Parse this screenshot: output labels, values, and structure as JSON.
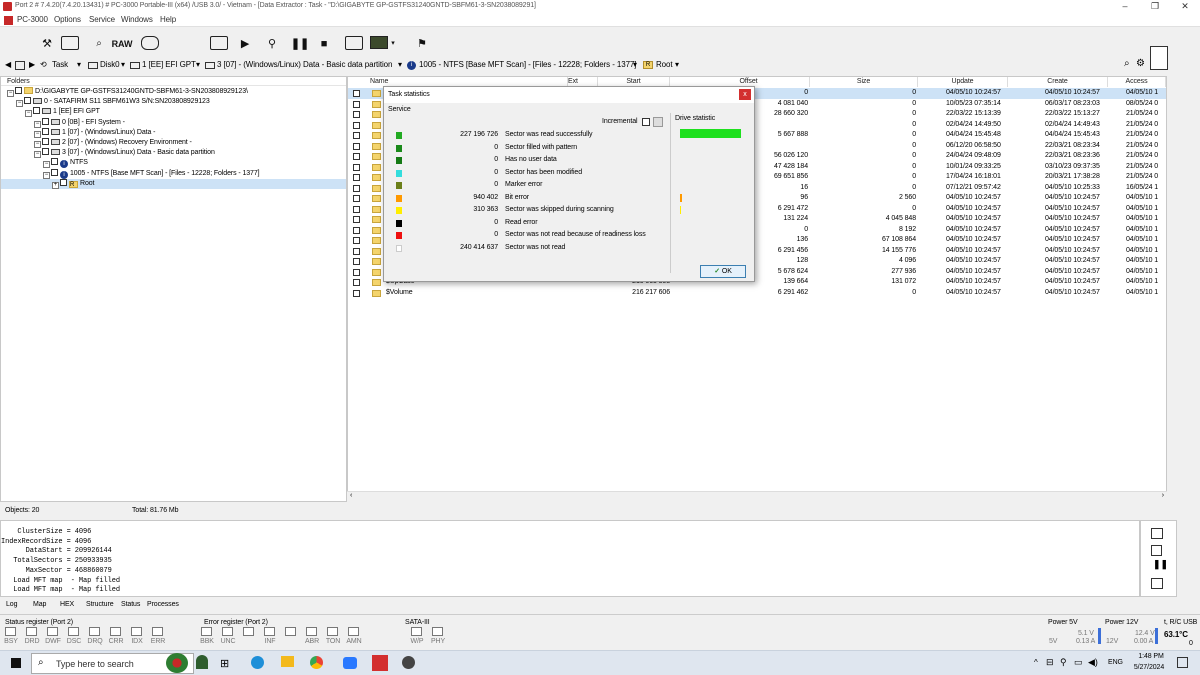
{
  "window": {
    "title": "Port 2 # 7.4.20(7.4.20.13431) # PC-3000 Portable-III (x64) /USB 3.0/ - Vietnam - [Data Extractor : Task - \"D:\\GIGABYTE GP-GSTFS31240GNTD-SBFM61-3-SN2038089291]"
  },
  "menu": {
    "items": [
      "PC-3000",
      "Options",
      "Service",
      "Windows",
      "Help"
    ]
  },
  "toolbar": {
    "raw_label": "RAW"
  },
  "nav": {
    "task": "Task",
    "disk": "Disk0",
    "efi": "1 [EE] EFI GPT",
    "part": "3 [07] - (Windows/Linux) Data - Basic data partition",
    "ntfs": "1005 - NTFS [Base MFT Scan] - [Files - 12228; Folders - 1377]",
    "root": "Root"
  },
  "folders": {
    "header": "Folders",
    "tree": [
      {
        "label": "D:\\GIGABYTE GP-GSTFS31240GNTD-SBFM61-3-SN203808929123\\",
        "indent": 0,
        "icon": "folder"
      },
      {
        "label": "0 - SATAFIRM   S11 SBFM61W3 S/N:SN203808929123",
        "indent": 1,
        "icon": "disk"
      },
      {
        "label": "1 [EE] EFI GPT",
        "indent": 2,
        "icon": "disk"
      },
      {
        "label": "0 [0B] - EFI System -",
        "indent": 3,
        "icon": "disk"
      },
      {
        "label": "1 [07] - (Windows/Linux) Data -",
        "indent": 3,
        "icon": "disk"
      },
      {
        "label": "2 [07] - (Windows) Recovery Environment -",
        "indent": 3,
        "icon": "disk"
      },
      {
        "label": "3 [07] - (Windows/Linux) Data - Basic data partition",
        "indent": 3,
        "icon": "disk"
      },
      {
        "label": "NTFS",
        "indent": 4,
        "icon": "info"
      },
      {
        "label": "1005 - NTFS [Base MFT Scan] - [Files - 12228; Folders - 1377]",
        "indent": 4,
        "icon": "info"
      },
      {
        "label": "Root",
        "indent": 5,
        "icon": "root"
      }
    ]
  },
  "files": {
    "columns": {
      "name": "Name",
      "ext": "Ext",
      "start": "Start",
      "offset": "Offset",
      "size": "Size",
      "update": "Update",
      "create": "Create",
      "access": "Access"
    },
    "rows": [
      {
        "name": "",
        "start": "",
        "offset": "0",
        "size": "0",
        "update": "04/05/10 10:24:57",
        "create": "04/05/10 10:24:57",
        "access": "04/05/10 1"
      },
      {
        "name": "",
        "start": "",
        "offset": "4 081 040",
        "size": "0",
        "update": "10/05/23 07:35:14",
        "create": "06/03/17 08:23:03",
        "access": "08/05/24 0"
      },
      {
        "name": "",
        "start": "",
        "offset": "28 660 320",
        "size": "0",
        "update": "22/03/22 15:13:39",
        "create": "22/03/22 15:13:27",
        "access": "21/05/24 0"
      },
      {
        "name": "",
        "start": "",
        "offset": "",
        "size": "0",
        "update": "02/04/24 14:49:50",
        "create": "02/04/24 14:49:43",
        "access": "21/05/24 0"
      },
      {
        "name": "",
        "start": "",
        "offset": "5 667 888",
        "size": "0",
        "update": "04/04/24 15:45:48",
        "create": "04/04/24 15:45:43",
        "access": "21/05/24 0"
      },
      {
        "name": "",
        "start": "",
        "offset": "",
        "size": "0",
        "update": "06/12/20 06:58:50",
        "create": "22/03/21 08:23:34",
        "access": "21/05/24 0"
      },
      {
        "name": "",
        "start": "",
        "offset": "56 026 120",
        "size": "0",
        "update": "24/04/24 09:48:09",
        "create": "22/03/21 08:23:36",
        "access": "21/05/24 0"
      },
      {
        "name": "",
        "start": "",
        "offset": "47 428 184",
        "size": "0",
        "update": "10/01/24 09:33:25",
        "create": "03/10/23 09:37:35",
        "access": "21/05/24 0"
      },
      {
        "name": "",
        "start": "",
        "offset": "69 651 856",
        "size": "0",
        "update": "17/04/24 16:18:01",
        "create": "20/03/21 17:38:28",
        "access": "21/05/24 0"
      },
      {
        "name": "",
        "start": "",
        "offset": "16",
        "size": "0",
        "update": "07/12/21 09:57:42",
        "create": "04/05/10 10:25:33",
        "access": "16/05/24 1"
      },
      {
        "name": "",
        "start": "",
        "offset": "96",
        "size": "2 560",
        "update": "04/05/10 10:24:57",
        "create": "04/05/10 10:24:57",
        "access": "04/05/10 1"
      },
      {
        "name": "",
        "start": "",
        "offset": "6 291 472",
        "size": "0",
        "update": "04/05/10 10:24:57",
        "create": "04/05/10 10:24:57",
        "access": "04/05/10 1"
      },
      {
        "name": "",
        "start": "",
        "offset": "131 224",
        "size": "4 045 848",
        "update": "04/05/10 10:24:57",
        "create": "04/05/10 10:24:57",
        "access": "04/05/10 1"
      },
      {
        "name": "",
        "start": "",
        "offset": "0",
        "size": "8 192",
        "update": "04/05/10 10:24:57",
        "create": "04/05/10 10:24:57",
        "access": "04/05/10 1"
      },
      {
        "name": "",
        "start": "",
        "offset": "136",
        "size": "67 108 864",
        "update": "04/05/10 10:24:57",
        "create": "04/05/10 10:24:57",
        "access": "04/05/10 1"
      },
      {
        "name": "",
        "start": "",
        "offset": "6 291 456",
        "size": "14 155 776",
        "update": "04/05/10 10:24:57",
        "create": "04/05/10 10:24:57",
        "access": "04/05/10 1"
      },
      {
        "name": "",
        "start": "",
        "offset": "128",
        "size": "4 096",
        "update": "04/05/10 10:24:57",
        "create": "04/05/10 10:24:57",
        "access": "04/05/10 1"
      },
      {
        "name": "",
        "start": "",
        "offset": "5 678 624",
        "size": "277 936",
        "update": "04/05/10 10:24:57",
        "create": "04/05/10 10:24:57",
        "access": "04/05/10 1"
      },
      {
        "name": "$UpCase",
        "start": "210 065 808",
        "offset": "139 664",
        "size": "131 072",
        "update": "04/05/10 10:24:57",
        "create": "04/05/10 10:24:57",
        "access": "04/05/10 1"
      },
      {
        "name": "$Volume",
        "start": "216 217 606",
        "offset": "6 291 462",
        "size": "0",
        "update": "04/05/10 10:24:57",
        "create": "04/05/10 10:24:57",
        "access": "04/05/10 1"
      }
    ]
  },
  "dialog": {
    "title": "Task statistics",
    "service": "Service",
    "incremental": "Incremental",
    "drive_statistic": "Drive statistic",
    "ok": "OK",
    "stats": [
      {
        "value": "227 196 726",
        "label": "Sector was read successfully",
        "color": "#22aa22"
      },
      {
        "value": "0",
        "label": "Sector filled with pattern",
        "color": "#1a8a1a"
      },
      {
        "value": "0",
        "label": "Has no user data",
        "color": "#157a15"
      },
      {
        "value": "0",
        "label": "Sector has been modified",
        "color": "#33dddd"
      },
      {
        "value": "0",
        "label": "Marker error",
        "color": "#6b7f1a"
      },
      {
        "value": "940 402",
        "label": "Bit error",
        "color": "#ff9900"
      },
      {
        "value": "310 363",
        "label": "Sector was skipped during scanning",
        "color": "#ffee00"
      },
      {
        "value": "0",
        "label": "Read error",
        "color": "#000000"
      },
      {
        "value": "0",
        "label": "Sector was not read because of readiness loss",
        "color": "#ee1111"
      },
      {
        "value": "240 414 637",
        "label": "Sector was not read",
        "color": "#ffffff"
      }
    ]
  },
  "objects": {
    "count": "Objects: 20",
    "total": "Total: 81.76 Mb"
  },
  "log": {
    "lines": [
      "    ClusterSize = 4096",
      "IndexRecordSize = 4096",
      "      DataStart = 209926144",
      "   TotalSectors = 250933935",
      "      MaxSector = 468860079",
      "   Load MFT map  - Map filled",
      "   Load MFT map  - Map filled"
    ]
  },
  "bottom_tabs": [
    "Log",
    "Map",
    "HEX",
    "Structure",
    "Status",
    "Processes"
  ],
  "status": {
    "status_reg_title": "Status register (Port 2)",
    "error_reg_title": "Error register (Port 2)",
    "sata_title": "SATA-III",
    "status_bits": [
      "BSY",
      "DRD",
      "DWF",
      "DSC",
      "DRQ",
      "CRR",
      "IDX",
      "ERR"
    ],
    "error_bits": [
      "BBK",
      "UNC",
      "",
      "INF",
      "",
      "ABR",
      "TON",
      "AMN"
    ],
    "sata_bits": [
      "W/P",
      "PHY"
    ],
    "power5": "Power 5V",
    "power5_v": "5.1 V",
    "power5_a": "0.13 A",
    "power5_lbl": "5V",
    "power12": "Power 12V",
    "power12_v": "12.4 V",
    "power12_a": "0.00 A",
    "power12_lbl": "12V",
    "temp_title": "t, R/C USB",
    "temp": "63.1°C",
    "temp_sub": "0"
  },
  "taskbar": {
    "search": "Type here to search",
    "lang": "ENG",
    "time": "1:48 PM",
    "date": "5/27/2024"
  }
}
